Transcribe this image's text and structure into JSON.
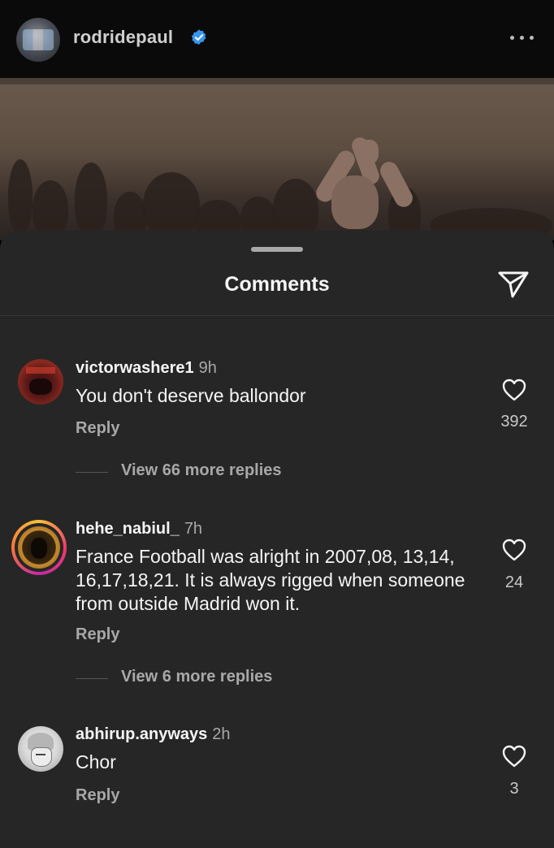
{
  "post": {
    "username": "rodridepaul",
    "verified_icon": "verified-badge-icon",
    "more_icon": "more-options-icon"
  },
  "sheet": {
    "title": "Comments",
    "share_icon": "send-icon"
  },
  "comments": [
    {
      "username": "victorwashere1",
      "time": "9h",
      "text": "You don't deserve ballondor",
      "reply_label": "Reply",
      "likes": "392",
      "view_replies": "View 66 more replies"
    },
    {
      "username": "hehe_nabiul_",
      "time": "7h",
      "text": "France Football was alright in 2007,08, 13,14, 16,17,18,21. It is always rigged when someone from outside Madrid won it.",
      "reply_label": "Reply",
      "likes": "24",
      "view_replies": "View 6 more replies"
    },
    {
      "username": "abhirup.anyways",
      "time": "2h",
      "text": "Chor",
      "reply_label": "Reply",
      "likes": "3"
    }
  ],
  "colors": {
    "sheet_bg": "#262626",
    "secondary_text": "#a8a8a8",
    "verified": "#3797f0"
  }
}
